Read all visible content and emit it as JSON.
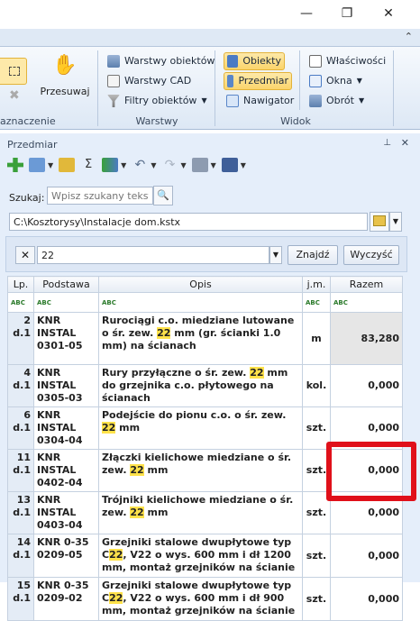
{
  "window": {
    "minimize_glyph": "—",
    "restore_glyph": "❐",
    "close_glyph": "✕"
  },
  "ribbon": {
    "collapse_glyph": "⌃",
    "selection_group_label": "aznaczenie",
    "move_label": "Przesuwaj",
    "layers_group": {
      "label": "Warstwy",
      "items": [
        "Warstwy obiektów",
        "Warstwy CAD",
        "Filtry obiektów"
      ]
    },
    "view_group": {
      "label": "Widok",
      "items": [
        "Obiekty",
        "Przedmiar",
        "Nawigator"
      ],
      "side_items": [
        "Właściwości",
        "Okna",
        "Obrót"
      ]
    }
  },
  "panel": {
    "title": "Przedmiar",
    "pin_glyph": "📌",
    "close_glyph": "✕",
    "search_label": "Szukaj:",
    "search_placeholder": "Wpisz szukany tekst...",
    "file_path": "C:\\Kosztorysy\\Instalacje dom.kstx",
    "filter_value": "22",
    "find_button": "Znajdź",
    "clear_button": "Wyczyść"
  },
  "table": {
    "columns": [
      "Lp.",
      "Podstawa",
      "Opis",
      "j.m.",
      "Razem"
    ],
    "filter_badge": "ABC",
    "rows": [
      {
        "lp": "2",
        "sub": "d.1",
        "pod1": "KNR INSTAL",
        "pod2": "0301-05",
        "opis_pre": "Rurociągi c.o. miedziane lutowane o śr. zew. ",
        "opis_hl": "22",
        "opis_post": " mm (gr. ścianki 1.0 mm) na ścianach",
        "jm": "m",
        "razem": "83,280"
      },
      {
        "lp": "4",
        "sub": "d.1",
        "pod1": "KNR INSTAL",
        "pod2": "0305-03",
        "opis_pre": "Rury przyłączne o śr. zew. ",
        "opis_hl": "22",
        "opis_post": " mm do grzejnika c.o. płytowego na ścianach",
        "jm": "kol.",
        "razem": "0,000"
      },
      {
        "lp": "6",
        "sub": "d.1",
        "pod1": "KNR INSTAL",
        "pod2": "0304-04",
        "opis_pre": "Podejście do pionu c.o. o śr. zew. ",
        "opis_hl": "22",
        "opis_post": " mm",
        "jm": "szt.",
        "razem": "0,000"
      },
      {
        "lp": "11",
        "sub": "d.1",
        "pod1": "KNR INSTAL",
        "pod2": "0402-04",
        "opis_pre": "Złączki kielichowe miedziane o śr. zew. ",
        "opis_hl": "22",
        "opis_post": " mm",
        "jm": "szt.",
        "razem": "0,000"
      },
      {
        "lp": "13",
        "sub": "d.1",
        "pod1": "KNR INSTAL",
        "pod2": "0403-04",
        "opis_pre": "Trójniki kielichowe miedziane o śr. zew. ",
        "opis_hl": "22",
        "opis_post": " mm",
        "jm": "szt.",
        "razem": "0,000"
      },
      {
        "lp": "14",
        "sub": "d.1",
        "pod1": "KNR 0-35",
        "pod2": "0209-05",
        "opis_pre": "Grzejniki stalowe dwupłytowe typ C",
        "opis_hl": "22",
        "opis_post": ", V22 o wys. 600 mm i dł 1200 mm, montaż grzejników na ścianie",
        "jm": "szt.",
        "razem": "0,000"
      },
      {
        "lp": "15",
        "sub": "d.1",
        "pod1": "KNR 0-35",
        "pod2": "0209-02",
        "opis_pre": "Grzejniki stalowe dwupłytowe typ C",
        "opis_hl": "22",
        "opis_post": ", V22 o wys. 600 mm i dł 900 mm, montaż grzejników na ścianie",
        "jm": "szt.",
        "razem": "0,000"
      }
    ]
  }
}
